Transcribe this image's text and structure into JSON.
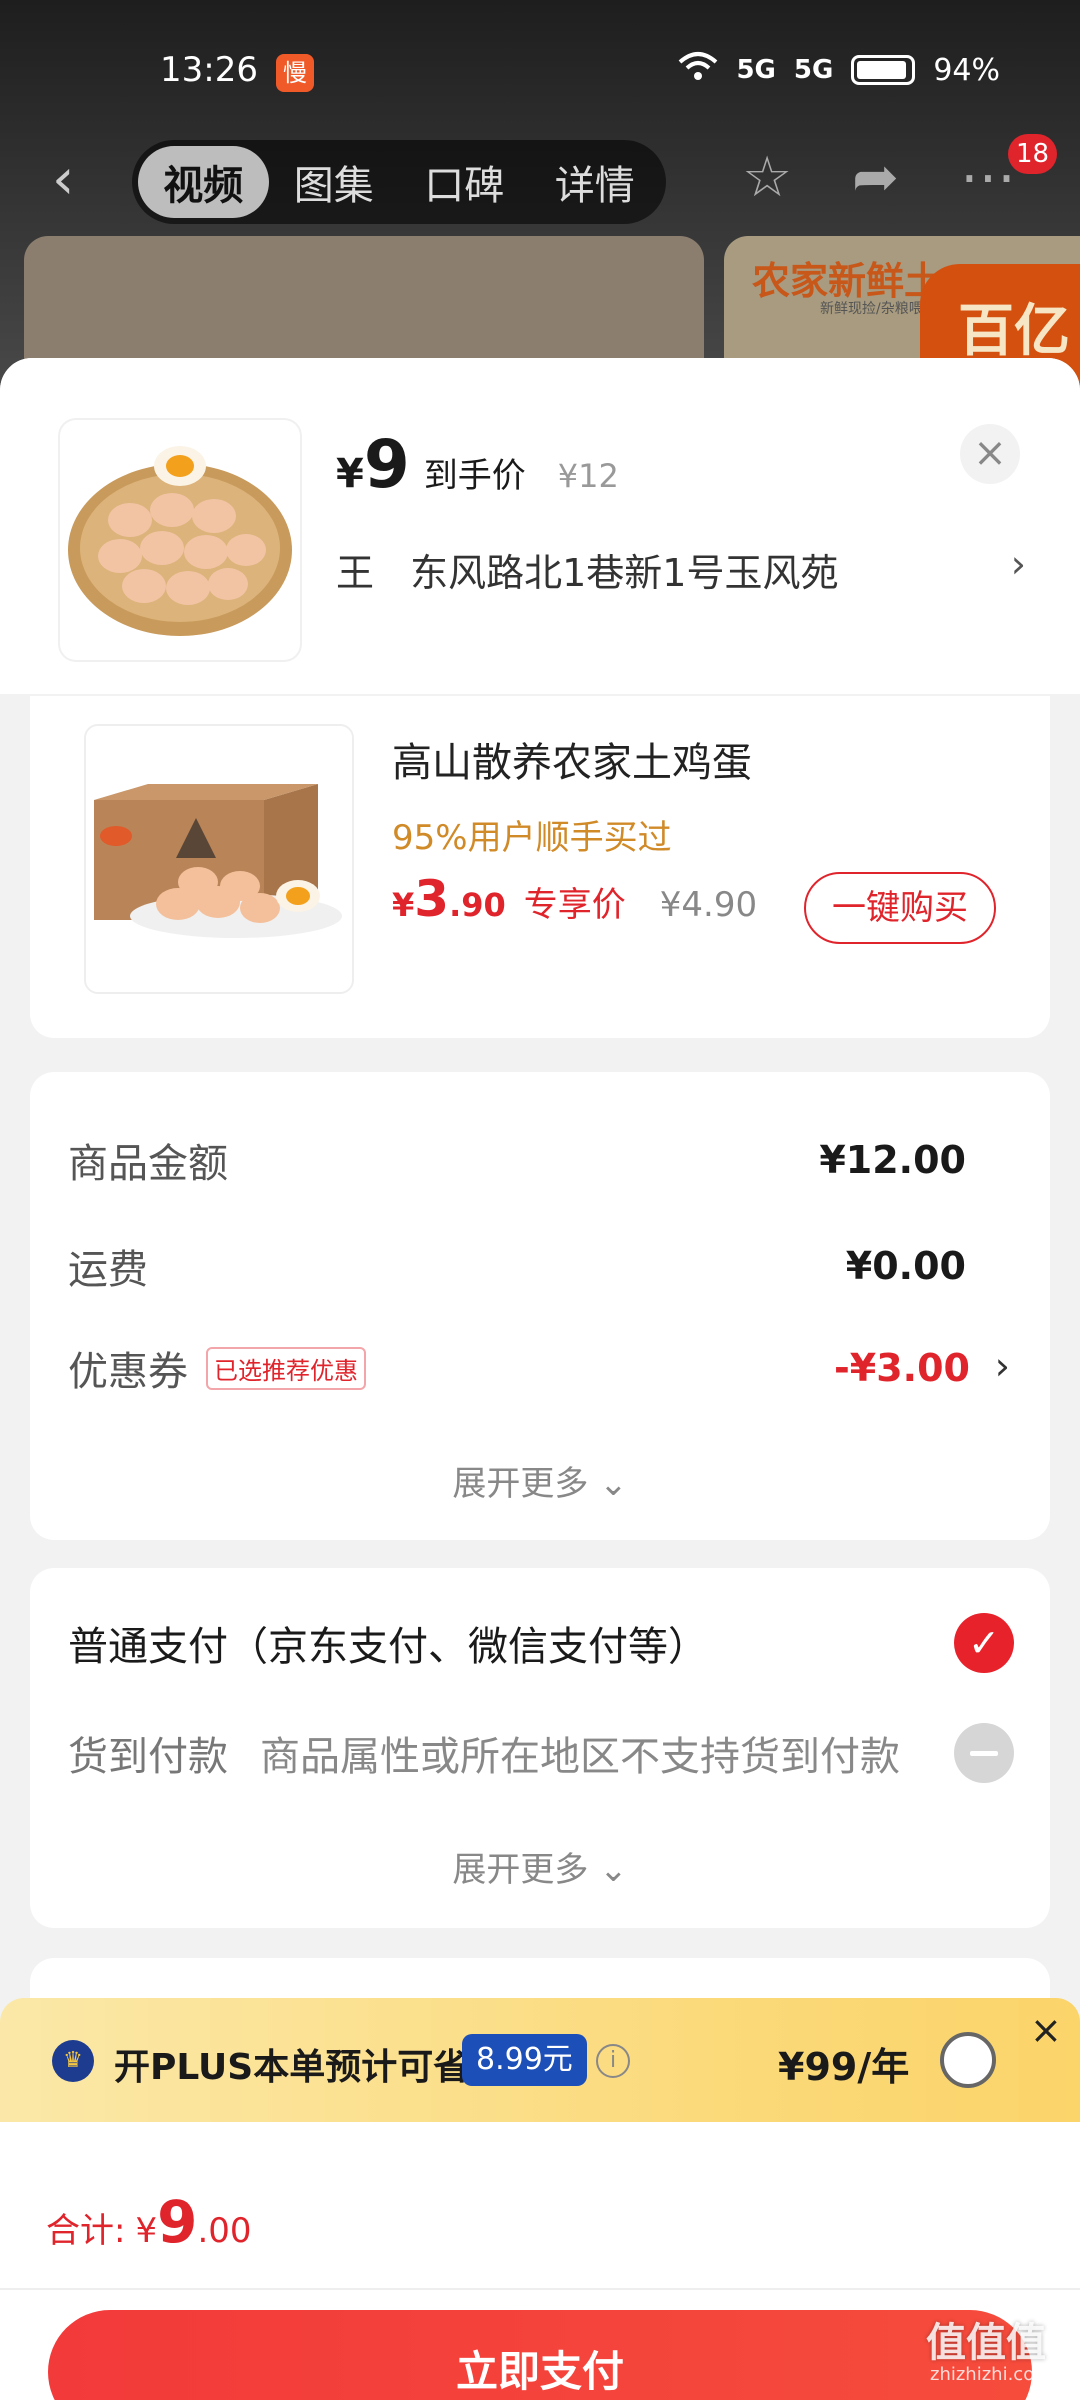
{
  "status_bar": {
    "time": "13:26",
    "app_badge": "慢",
    "battery_pct": "94%",
    "signal_1": "5G",
    "signal_2": "5G"
  },
  "nav": {
    "tabs": [
      {
        "label": "视频"
      },
      {
        "label": "图集"
      },
      {
        "label": "口碑"
      },
      {
        "label": "详情"
      }
    ],
    "cart_badge": "18"
  },
  "background": {
    "banner_text": "农家新鲜土",
    "banner_sub": "新鲜现捡/杂粮喂养",
    "promo_tag": "百亿"
  },
  "sheet": {
    "price_symbol": "¥",
    "price": "9",
    "price_tag": "到手价",
    "original_price": "¥12",
    "address_name": "王",
    "address": "东风路北1巷新1号玉风苑"
  },
  "upsell": {
    "title": "高山散养农家土鸡蛋",
    "subtitle": "95%用户顺手买过",
    "price_symbol": "¥",
    "price_int": "3",
    "price_dec": ".90",
    "price_tag": "专享价",
    "original_price": "¥4.90",
    "buy_label": "一键购买"
  },
  "amount": {
    "goods_label": "商品金额",
    "goods_value": "¥12.00",
    "shipping_label": "运费",
    "shipping_value": "¥0.00",
    "coupon_label": "优惠券",
    "coupon_badge": "已选推荐优惠",
    "coupon_value": "-¥3.00",
    "expand_label": "展开更多"
  },
  "payment": {
    "normal_label": "普通支付（京东支付、微信支付等）",
    "cod_label": "货到付款",
    "cod_note": "商品属性或所在地区不支持货到付款",
    "expand_label": "展开更多"
  },
  "plus": {
    "text": "开PLUS本单预计可省",
    "save_amount": "8.99元",
    "price": "¥99/年"
  },
  "footer": {
    "total_label": "合计:",
    "total_symbol": "¥",
    "total_int": "9",
    "total_dec": ".00",
    "pay_label": "立即支付"
  },
  "watermark": {
    "text": "值值值",
    "sub": "zhizhizhi.com"
  },
  "colors": {
    "accent_red": "#e0242c",
    "plus_blue": "#1d4fb8",
    "plus_gold": "#fbd978"
  }
}
